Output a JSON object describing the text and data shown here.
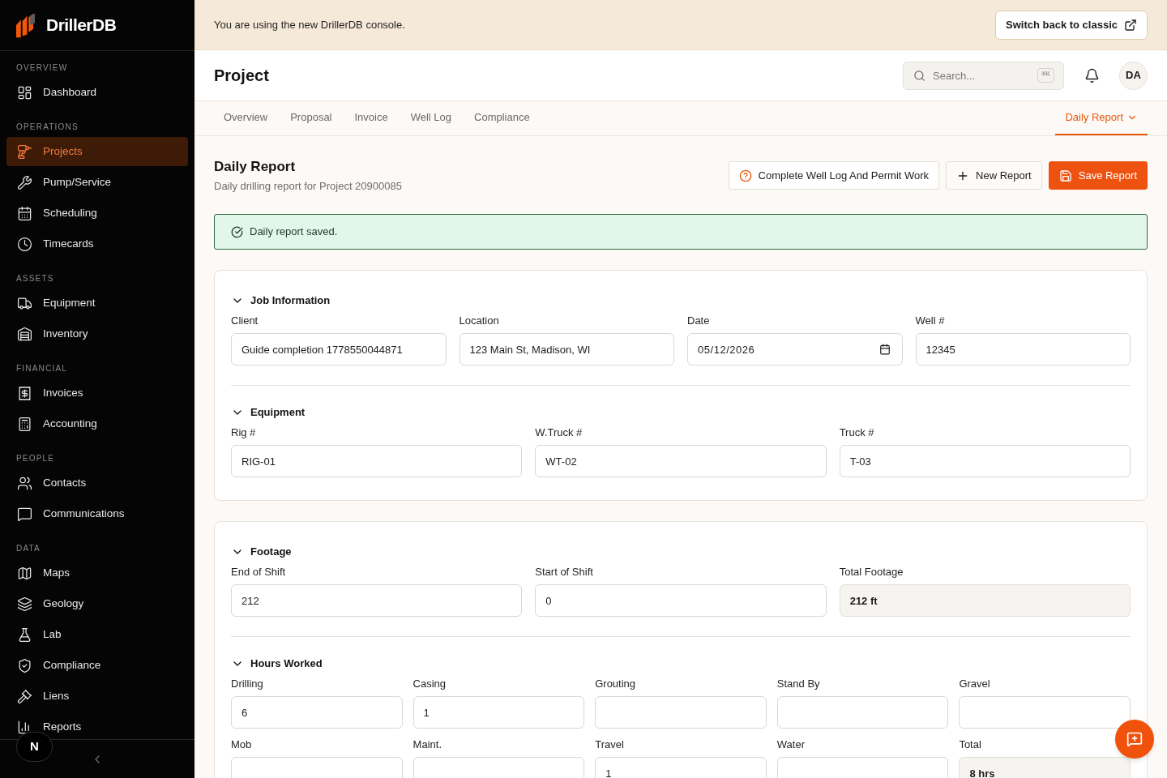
{
  "sidebar": {
    "brand": "DrillerDB",
    "sections": [
      {
        "title": "OVERVIEW",
        "items": [
          {
            "label": "Dashboard",
            "selected": false
          }
        ]
      },
      {
        "title": "OPERATIONS",
        "items": [
          {
            "label": "Projects",
            "selected": true
          },
          {
            "label": "Pump/Service",
            "selected": false
          },
          {
            "label": "Scheduling",
            "selected": false
          },
          {
            "label": "Timecards",
            "selected": false
          }
        ]
      },
      {
        "title": "ASSETS",
        "items": [
          {
            "label": "Equipment",
            "selected": false
          },
          {
            "label": "Inventory",
            "selected": false
          }
        ]
      },
      {
        "title": "FINANCIAL",
        "items": [
          {
            "label": "Invoices",
            "selected": false
          },
          {
            "label": "Accounting",
            "selected": false
          }
        ]
      },
      {
        "title": "PEOPLE",
        "items": [
          {
            "label": "Contacts",
            "selected": false
          },
          {
            "label": "Communications",
            "selected": false
          }
        ]
      },
      {
        "title": "DATA",
        "items": [
          {
            "label": "Maps",
            "selected": false
          },
          {
            "label": "Geology",
            "selected": false
          },
          {
            "label": "Lab",
            "selected": false
          },
          {
            "label": "Compliance",
            "selected": false
          },
          {
            "label": "Liens",
            "selected": false
          },
          {
            "label": "Reports",
            "selected": false
          }
        ]
      }
    ],
    "dev_badge": "N"
  },
  "banner": {
    "message": "You are using the new DrillerDB console.",
    "button": "Switch back to classic"
  },
  "header": {
    "title": "Project",
    "search": {
      "placeholder": "Search...",
      "shortcut": "⌘K"
    },
    "avatar": "DA"
  },
  "tabs": [
    {
      "label": "Overview",
      "selected": false,
      "kind": "link"
    },
    {
      "label": "Proposal",
      "selected": false,
      "kind": "link"
    },
    {
      "label": "Invoice",
      "selected": false,
      "kind": "link"
    },
    {
      "label": "Well Log",
      "selected": false,
      "kind": "link"
    },
    {
      "label": "Compliance",
      "selected": false,
      "kind": "link"
    },
    {
      "label": "Daily Report",
      "selected": true,
      "kind": "menu"
    }
  ],
  "page": {
    "title": "Daily Report",
    "subtitle": "Daily drilling report for Project 20900085",
    "actions": [
      {
        "label": "Complete Well Log And Permit Work",
        "kind": "help"
      },
      {
        "label": "New Report",
        "kind": "secondary"
      },
      {
        "label": "Save Report",
        "kind": "primary"
      }
    ]
  },
  "alert": {
    "kind": "success",
    "message": "Daily report saved."
  },
  "cards": [
    {
      "sections": [
        {
          "title": "Job Information",
          "expanded": true,
          "rows": [
            [
              {
                "label": "Client",
                "value": "Guide completion 1778550044871",
                "kind": "text"
              },
              {
                "label": "Location",
                "value": "123 Main St, Madison, WI",
                "kind": "text"
              },
              {
                "label": "Date",
                "value": "05/12/2026",
                "kind": "date"
              },
              {
                "label": "Well #",
                "value": "12345",
                "kind": "text"
              }
            ]
          ]
        },
        {
          "title": "Equipment",
          "expanded": true,
          "rows": [
            [
              {
                "label": "Rig #",
                "value": "RIG-01",
                "kind": "text"
              },
              {
                "label": "W.Truck #",
                "value": "WT-02",
                "kind": "text"
              },
              {
                "label": "Truck #",
                "value": "T-03",
                "kind": "text"
              }
            ]
          ]
        }
      ]
    },
    {
      "sections": [
        {
          "title": "Footage",
          "expanded": true,
          "rows": [
            [
              {
                "label": "End of Shift",
                "value": "212",
                "kind": "text"
              },
              {
                "label": "Start of Shift",
                "value": "0",
                "kind": "text"
              },
              {
                "label": "Total Footage",
                "value": "212 ft",
                "kind": "computed"
              }
            ]
          ]
        },
        {
          "title": "Hours Worked",
          "expanded": true,
          "rows": [
            [
              {
                "label": "Drilling",
                "value": "6",
                "kind": "text"
              },
              {
                "label": "Casing",
                "value": "1",
                "kind": "text"
              },
              {
                "label": "Grouting",
                "kind": "text"
              },
              {
                "label": "Stand By",
                "kind": "text"
              },
              {
                "label": "Gravel",
                "kind": "text"
              }
            ],
            [
              {
                "label": "Mob",
                "kind": "text"
              },
              {
                "label": "Maint.",
                "kind": "text"
              },
              {
                "label": "Travel",
                "value": "1",
                "kind": "text"
              },
              {
                "label": "Water",
                "kind": "text"
              },
              {
                "label": "Total",
                "value": "8 hrs",
                "kind": "computed"
              }
            ]
          ]
        }
      ]
    }
  ]
}
